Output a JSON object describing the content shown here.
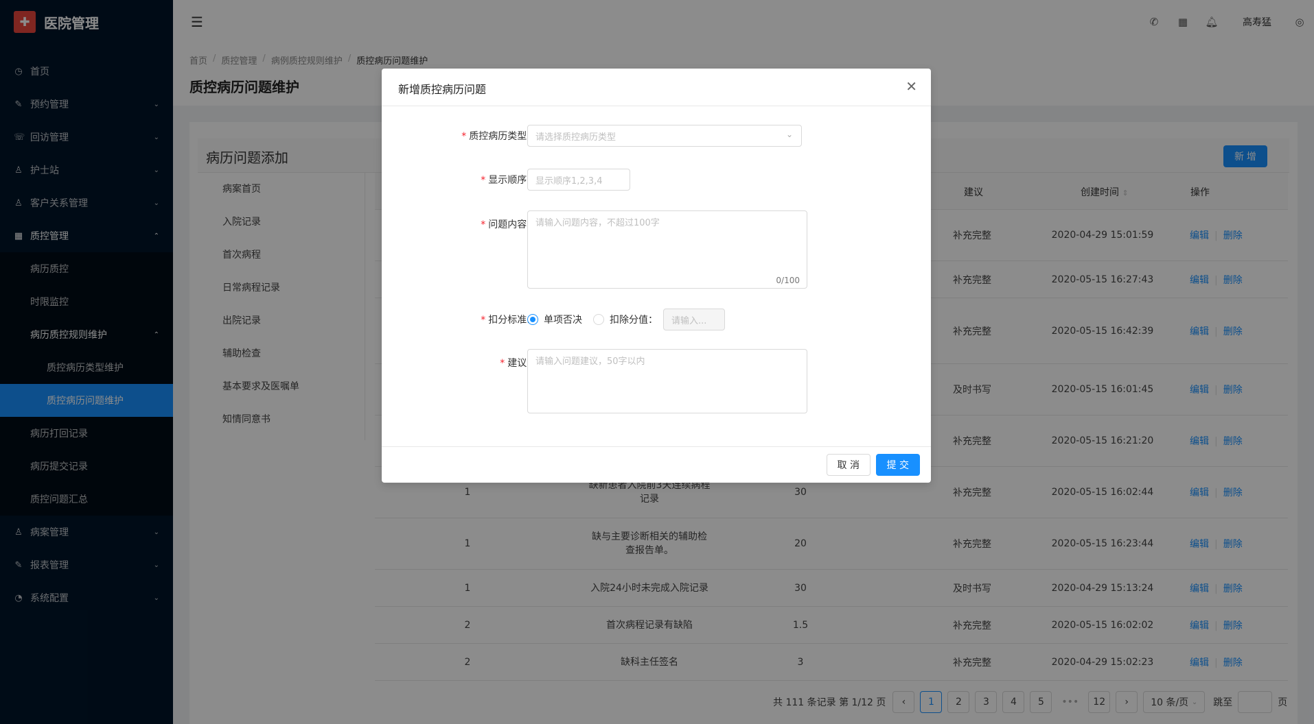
{
  "app": {
    "title": "医院管理",
    "logo_icon": "hospital-logo"
  },
  "sidebar": {
    "items": [
      {
        "label": "首页",
        "icon": "dashboard-icon"
      },
      {
        "label": "预约管理",
        "icon": "form-icon"
      },
      {
        "label": "回访管理",
        "icon": "phone-icon"
      },
      {
        "label": "护士站",
        "icon": "user-icon"
      },
      {
        "label": "客户关系管理",
        "icon": "team-icon"
      },
      {
        "label": "质控管理",
        "icon": "table-icon"
      },
      {
        "label": "病历质控"
      },
      {
        "label": "时限监控"
      },
      {
        "label": "病历质控规则维护"
      },
      {
        "label": "质控病历类型维护"
      },
      {
        "label": "质控病历问题维护"
      },
      {
        "label": "病历打回记录"
      },
      {
        "label": "病历提交记录"
      },
      {
        "label": "质控问题汇总"
      },
      {
        "label": "病案管理",
        "icon": "user-icon"
      },
      {
        "label": "报表管理",
        "icon": "form-icon"
      },
      {
        "label": "系统配置",
        "icon": "setting-icon"
      }
    ],
    "accent": "#1890ff"
  },
  "header": {
    "user": "高寿猛"
  },
  "breadcrumb": [
    "首页",
    "质控管理",
    "病例质控规则维护",
    "质控病历问题维护"
  ],
  "page_title": "质控病历问题维护",
  "card": {
    "title": "病历问题添加",
    "new_button": "新 增",
    "left_list": [
      "病案首页",
      "入院记录",
      "首次病程",
      "日常病程记录",
      "出院记录",
      "辅助检查",
      "基本要求及医嘱单",
      "知情同意书"
    ]
  },
  "table": {
    "columns": {
      "suggest": "建议",
      "created": "创建时间",
      "ops": "操作",
      "sort_icon": "sort-icon"
    },
    "rows": [
      {
        "order": "",
        "content": "",
        "score": "",
        "suggest": "补充完整",
        "created": "2020-04-29 15:01:59"
      },
      {
        "order": "",
        "content": "",
        "score": "",
        "suggest": "补充完整",
        "created": "2020-05-15 16:27:43"
      },
      {
        "order": "",
        "content": "",
        "score": "",
        "suggest": "补充完整",
        "created": "2020-05-15 16:42:39"
      },
      {
        "order": "",
        "content": "",
        "score": "",
        "suggest": "及时书写",
        "created": "2020-05-15 16:01:45"
      },
      {
        "order": "",
        "content": "",
        "score": "",
        "suggest": "补充完整",
        "created": "2020-05-15 16:21:20"
      },
      {
        "order": "1",
        "content": "缺新患者入院前3天连续病程\n记录",
        "score": "30",
        "suggest": "补充完整",
        "created": "2020-05-15 16:02:44"
      },
      {
        "order": "1",
        "content": "缺与主要诊断相关的辅助检\n查报告单。",
        "score": "20",
        "suggest": "补充完整",
        "created": "2020-05-15 16:23:44"
      },
      {
        "order": "1",
        "content": "入院24小时未完成入院记录",
        "score": "30",
        "suggest": "及时书写",
        "created": "2020-04-29 15:13:24"
      },
      {
        "order": "2",
        "content": "首次病程记录有缺陷",
        "score": "1.5",
        "suggest": "补充完整",
        "created": "2020-05-15 16:02:02"
      },
      {
        "order": "2",
        "content": "缺科主任签名",
        "score": "3",
        "suggest": "补充完整",
        "created": "2020-04-29 15:02:23"
      }
    ],
    "edit_label": "编辑",
    "delete_label": "删除"
  },
  "pagination": {
    "total_text": "共 111 条记录 第 1/12 页",
    "pages": [
      "1",
      "2",
      "3",
      "4",
      "5",
      "•••",
      "12"
    ],
    "current": "1",
    "page_size": "10 条/页",
    "jump_label": "跳至",
    "page_unit": "页"
  },
  "modal": {
    "title": "新增质控病历问题",
    "fields": {
      "type": {
        "label": "质控病历类型:",
        "placeholder": "请选择质控病历类型"
      },
      "order": {
        "label": "显示顺序:",
        "placeholder": "显示顺序1,2,3,4"
      },
      "content": {
        "label": "问题内容:",
        "placeholder": "请输入问题内容，不超过100字",
        "count": "0/100"
      },
      "deduct": {
        "label": "扣分标准:",
        "option1": "单项否决",
        "option2": "扣除分值：",
        "score_placeholder": "请输入..."
      },
      "suggest": {
        "label": "建议:",
        "placeholder": "请输入问题建议，50字以内"
      }
    },
    "cancel": "取 消",
    "submit": "提 交"
  }
}
